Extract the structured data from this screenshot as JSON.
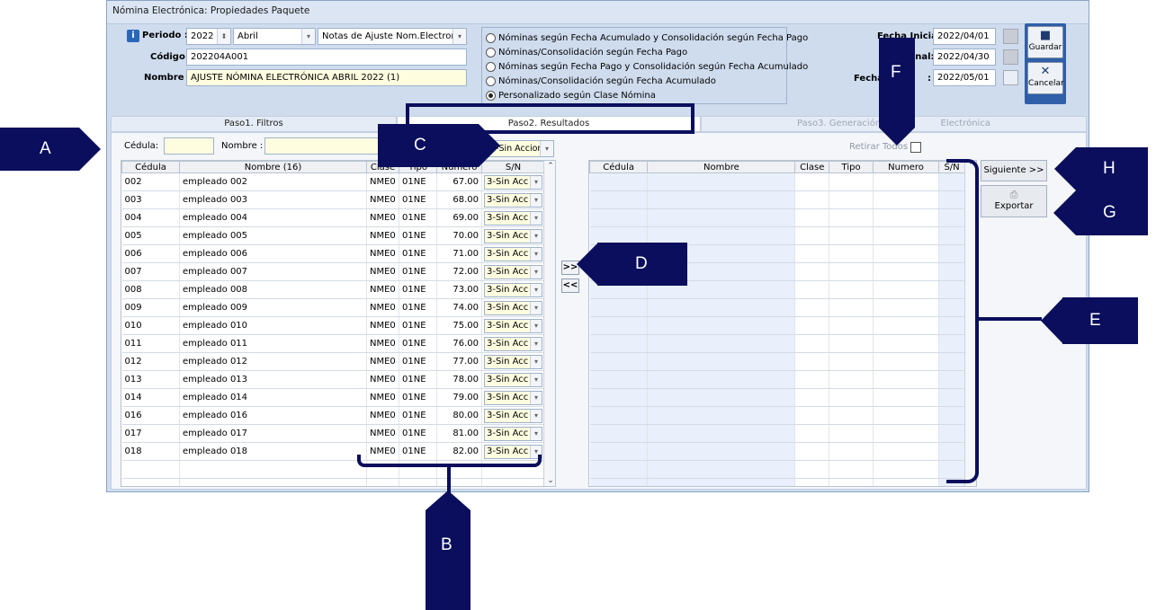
{
  "window": {
    "title": "Nómina Electrónica: Propiedades Paquete"
  },
  "header": {
    "periodo_label": "Periodo :",
    "year": "2022",
    "month": "Abril",
    "type": "Notas de Ajuste Nom.Electronic",
    "codigo_label": "Código :",
    "codigo": "202204A001",
    "nombre_label": "Nombre :",
    "nombre": "AJUSTE NÓMINA ELECTRÓNICA ABRIL 2022 (1)",
    "radios": [
      {
        "label": "Nóminas según Fecha Acumulado y Consolidación según Fecha Pago",
        "selected": false
      },
      {
        "label": "Nóminas/Consolidación según Fecha Pago",
        "selected": false
      },
      {
        "label": "Nóminas según Fecha Pago y Consolidación según Fecha Acumulado",
        "selected": false
      },
      {
        "label": "Nóminas/Consolidación según Fecha Acumulado",
        "selected": false
      },
      {
        "label": "Personalizado según Clase Nómina",
        "selected": true
      }
    ],
    "fecha_inicial_label": "Fecha Inicial:",
    "fecha_inicial": "2022/04/01",
    "fecha_final_label": "Final:",
    "fecha_final": "2022/04/30",
    "fecha_pago_label": "Fecha",
    "fecha_pago_label2": ":",
    "fecha_pago": "2022/05/01",
    "guardar": "Guardar",
    "cancelar": "Cancelar"
  },
  "tabs": [
    {
      "label": "Paso1. Filtros"
    },
    {
      "label": "Paso2. Resultados"
    },
    {
      "label": "Paso3. Generación",
      "suffix": "Electrónica"
    }
  ],
  "filters": {
    "cedula_label": "Cédula:",
    "nombre_label": "Nombre :",
    "accion": "3-Sin Accion",
    "retirar_todos": "Retirar Todos"
  },
  "left_table": {
    "columns": [
      "Cédula",
      "Nombre (16)",
      "Clase",
      "Tipo",
      "Numero",
      "S/N"
    ],
    "rows": [
      {
        "cedula": "002",
        "nombre": "empleado 002",
        "clase": "NME0",
        "tipo": "01NE",
        "numero": "67.00",
        "sn": "3-Sin Acc"
      },
      {
        "cedula": "003",
        "nombre": "empleado 003",
        "clase": "NME0",
        "tipo": "01NE",
        "numero": "68.00",
        "sn": "3-Sin Acc"
      },
      {
        "cedula": "004",
        "nombre": "empleado 004",
        "clase": "NME0",
        "tipo": "01NE",
        "numero": "69.00",
        "sn": "3-Sin Acc"
      },
      {
        "cedula": "005",
        "nombre": "empleado 005",
        "clase": "NME0",
        "tipo": "01NE",
        "numero": "70.00",
        "sn": "3-Sin Acc"
      },
      {
        "cedula": "006",
        "nombre": "empleado 006",
        "clase": "NME0",
        "tipo": "01NE",
        "numero": "71.00",
        "sn": "3-Sin Acc"
      },
      {
        "cedula": "007",
        "nombre": "empleado 007",
        "clase": "NME0",
        "tipo": "01NE",
        "numero": "72.00",
        "sn": "3-Sin Acc"
      },
      {
        "cedula": "008",
        "nombre": "empleado 008",
        "clase": "NME0",
        "tipo": "01NE",
        "numero": "73.00",
        "sn": "3-Sin Acc"
      },
      {
        "cedula": "009",
        "nombre": "empleado 009",
        "clase": "NME0",
        "tipo": "01NE",
        "numero": "74.00",
        "sn": "3-Sin Acc"
      },
      {
        "cedula": "010",
        "nombre": "empleado 010",
        "clase": "NME0",
        "tipo": "01NE",
        "numero": "75.00",
        "sn": "3-Sin Acc"
      },
      {
        "cedula": "011",
        "nombre": "empleado 011",
        "clase": "NME0",
        "tipo": "01NE",
        "numero": "76.00",
        "sn": "3-Sin Acc"
      },
      {
        "cedula": "012",
        "nombre": "empleado 012",
        "clase": "NME0",
        "tipo": "01NE",
        "numero": "77.00",
        "sn": "3-Sin Acc"
      },
      {
        "cedula": "013",
        "nombre": "empleado 013",
        "clase": "NME0",
        "tipo": "01NE",
        "numero": "78.00",
        "sn": "3-Sin Acc"
      },
      {
        "cedula": "014",
        "nombre": "empleado 014",
        "clase": "NME0",
        "tipo": "01NE",
        "numero": "79.00",
        "sn": "3-Sin Acc"
      },
      {
        "cedula": "016",
        "nombre": "empleado 016",
        "clase": "NME0",
        "tipo": "01NE",
        "numero": "80.00",
        "sn": "3-Sin Acc"
      },
      {
        "cedula": "017",
        "nombre": "empleado 017",
        "clase": "NME0",
        "tipo": "01NE",
        "numero": "81.00",
        "sn": "3-Sin Acc"
      },
      {
        "cedula": "018",
        "nombre": "empleado 018",
        "clase": "NME0",
        "tipo": "01NE",
        "numero": "82.00",
        "sn": "3-Sin Acc"
      }
    ]
  },
  "right_table": {
    "columns": [
      "Cédula",
      "Nombre",
      "Clase",
      "Tipo",
      "Numero",
      "S/N"
    ]
  },
  "move_buttons": {
    "add": ">>",
    "remove": "<<"
  },
  "side_buttons": {
    "siguiente": "Siguiente >>",
    "exportar": "Exportar"
  },
  "callouts": [
    "A",
    "B",
    "C",
    "D",
    "E",
    "F",
    "G",
    "H"
  ],
  "colors": {
    "callout": "#0a0e5c",
    "window_bg": "#cfdcee",
    "field_yellow": "#fffde0"
  }
}
